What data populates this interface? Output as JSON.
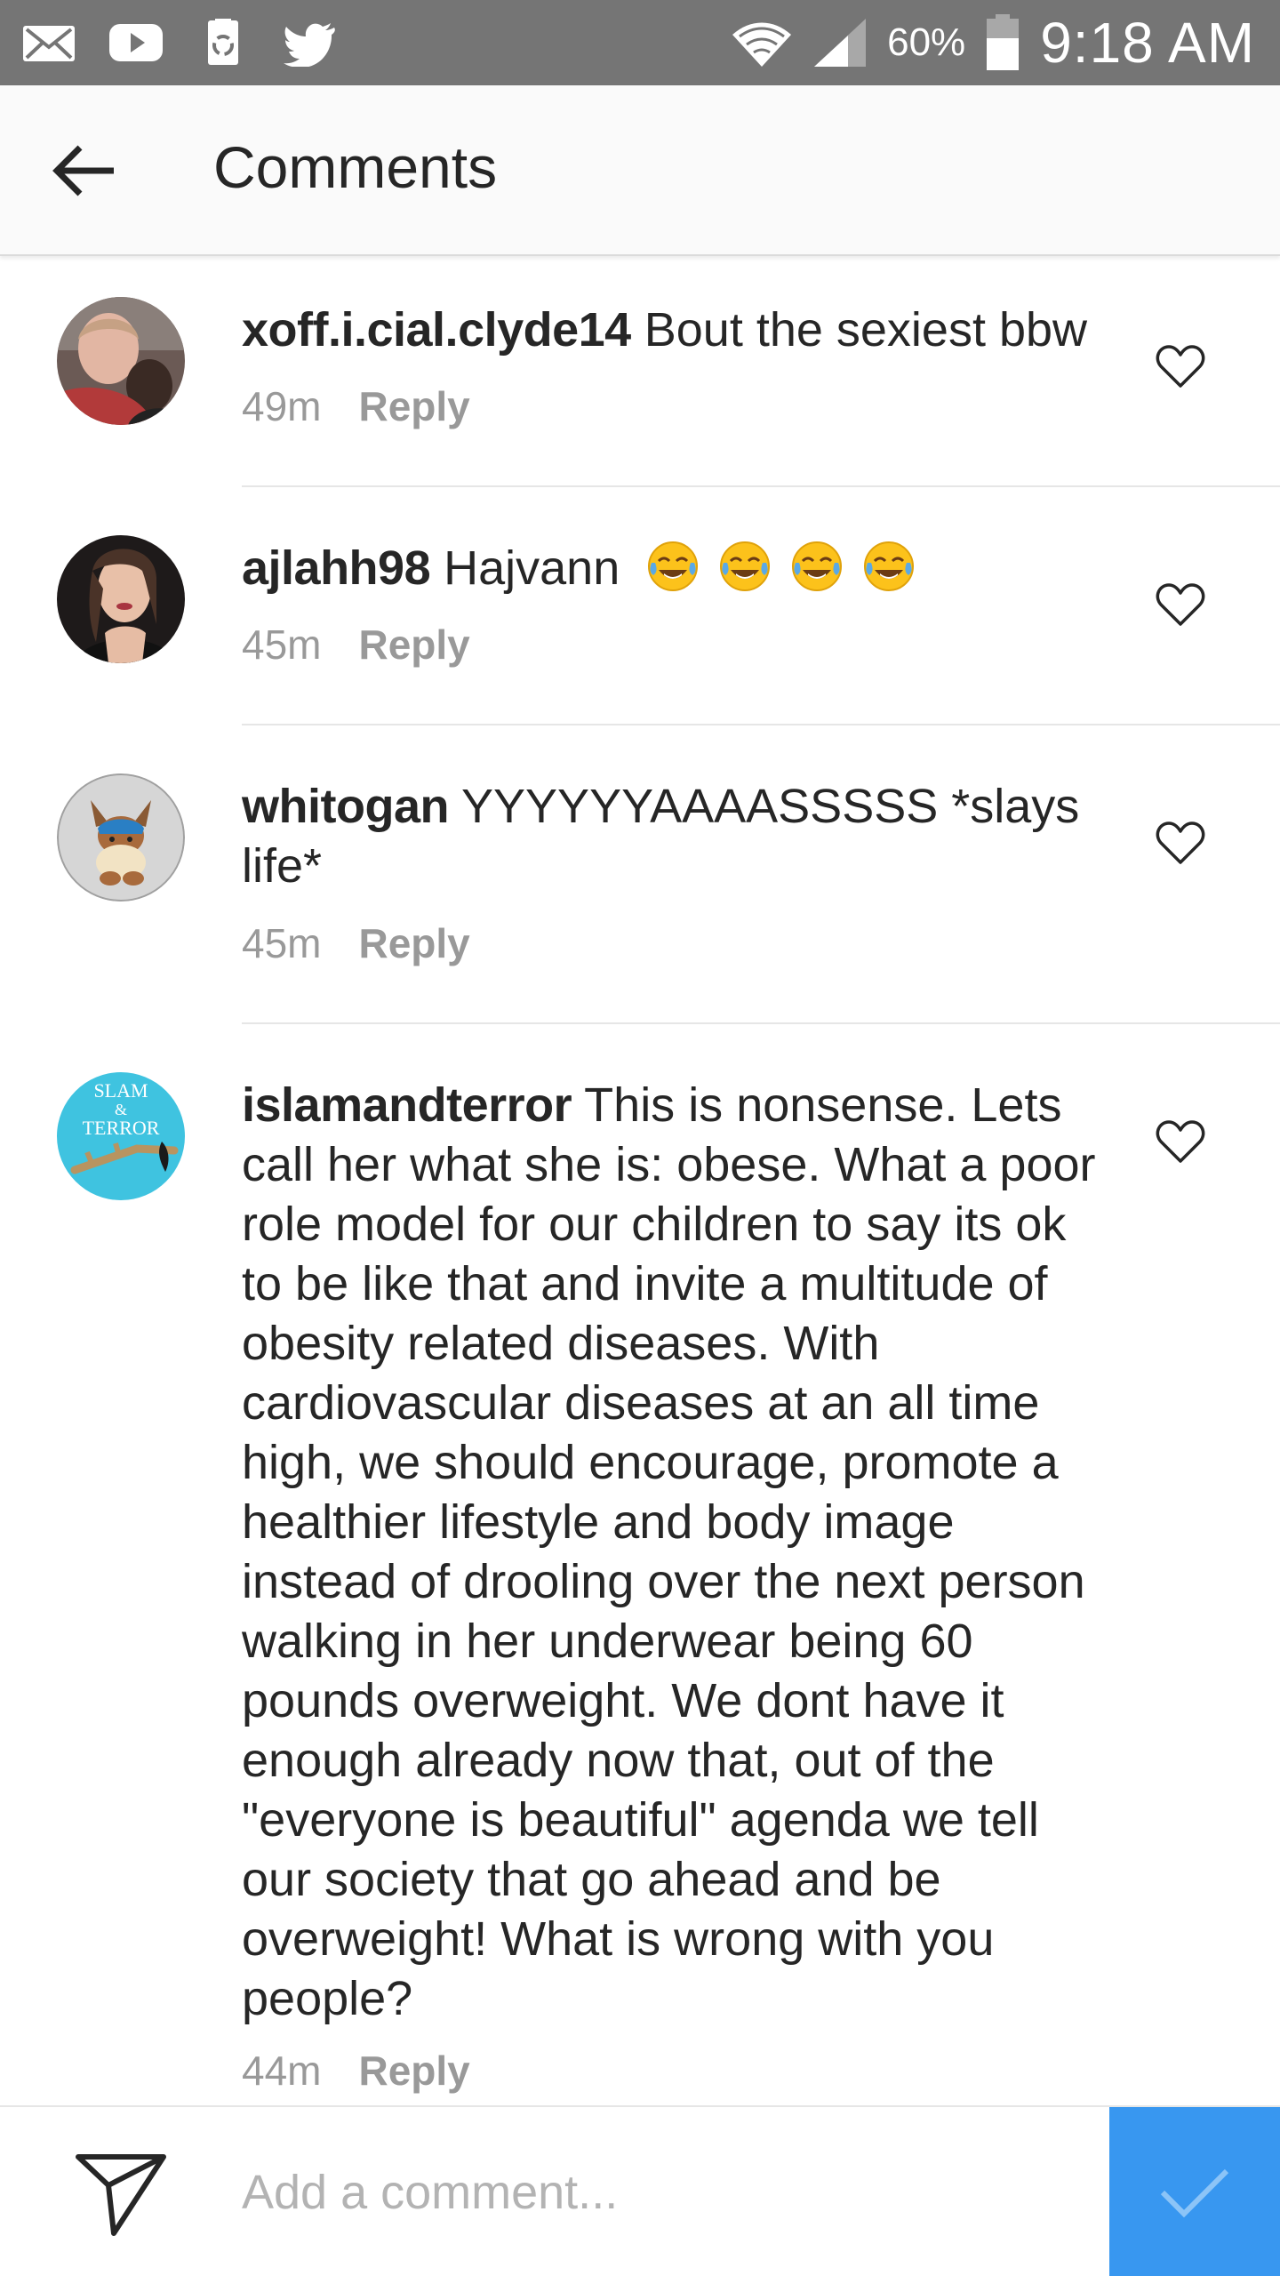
{
  "status_bar": {
    "battery": "60%",
    "time": "9:18 AM",
    "icons": [
      "mail-icon",
      "youtube-icon",
      "recycle-icon",
      "twitter-icon",
      "wifi-icon",
      "signal-icon",
      "battery-icon"
    ]
  },
  "header": {
    "title": "Comments",
    "back_icon": "arrow-left-icon"
  },
  "comments": [
    {
      "username": "xoff.i.cial.clyde14",
      "text": "Bout the sexiest bbw",
      "time": "49m",
      "reply": "Reply"
    },
    {
      "username": "ajlahh98",
      "text": "Hajvann",
      "emoji": "😂😂😂😂",
      "time": "45m",
      "reply": "Reply"
    },
    {
      "username": "whitogan",
      "text": "YYYYYYAAAASSSSS *slays life*",
      "time": "45m",
      "reply": "Reply"
    },
    {
      "username": "islamandterror",
      "text": "This is nonsense. Lets call her what she is: obese. What a poor role model for our children to say its ok to be like that and invite a multitude of obesity related diseases. With cardiovascular diseases at an all time high, we should encourage, promote a healthier lifestyle and body image instead of drooling over the next person walking in her underwear being 60 pounds overweight.  We dont have it enough already now that, out of the \"everyone is beautiful\" agenda we tell our society that go ahead and be overweight! What is wrong with you people?",
      "avatar_text_top": "SLAM",
      "avatar_text_mid": "&",
      "avatar_text_bottom": "TERROR",
      "time": "44m",
      "reply": "Reply"
    }
  ],
  "composer": {
    "placeholder": "Add a comment...",
    "post_icon": "checkmark-icon"
  },
  "colors": {
    "status_bar": "#757575",
    "header_bg": "#fafafa",
    "accent": "#3897f0",
    "meta_text": "#999999"
  }
}
